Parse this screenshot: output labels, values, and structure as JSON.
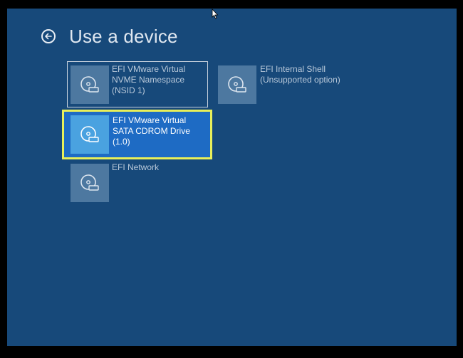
{
  "header": {
    "title": "Use a device"
  },
  "devices": [
    {
      "line1": "EFI VMware Virtual",
      "line2": "NVME Namespace",
      "line3": "(NSID 1)",
      "icon": "disc-drive-icon"
    },
    {
      "line1": "EFI Internal Shell",
      "line2": "(Unsupported option)",
      "line3": "",
      "icon": "disc-drive-icon"
    },
    {
      "line1": "EFI VMware Virtual",
      "line2": "SATA CDROM Drive",
      "line3": "(1.0)",
      "icon": "disc-drive-icon"
    },
    {
      "line1": "EFI Network",
      "line2": "",
      "line3": "",
      "icon": "disc-drive-icon"
    }
  ],
  "colors": {
    "background": "#17497a",
    "tile_icon": "#4d78a0",
    "selected_tile": "#1e6bc4",
    "focus_outline": "#e8ef5a",
    "hover_outline": "#c9d3de"
  }
}
